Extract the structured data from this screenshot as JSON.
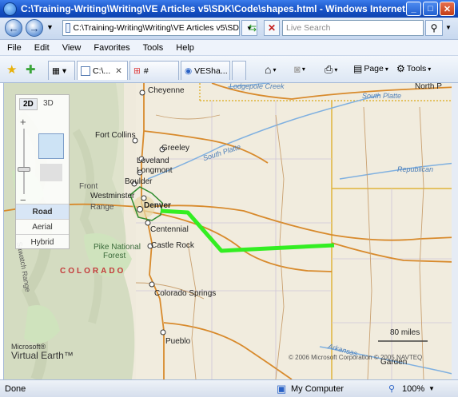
{
  "window": {
    "title": "C:\\Training-Writing\\Writing\\VE Articles v5\\SDK\\Code\\shapes.html - Windows Internet...",
    "minimize": "_",
    "maximize": "□",
    "close": "✕"
  },
  "navbar": {
    "address": "C:\\Training-Writing\\Writing\\VE Articles v5\\SD",
    "search_placeholder": "Live Search"
  },
  "menu": {
    "items": [
      "File",
      "Edit",
      "View",
      "Favorites",
      "Tools",
      "Help"
    ]
  },
  "tabs": [
    {
      "label": "C:\\...",
      "active": true
    },
    {
      "label": "#",
      "active": false
    },
    {
      "label": "VESha...",
      "active": false
    }
  ],
  "toolbar": {
    "page_label": "Page",
    "tools_label": "Tools"
  },
  "map": {
    "view_2d": "2D",
    "view_3d": "3D",
    "styles": [
      "Road",
      "Aerial",
      "Hybrid"
    ],
    "selected_style": "Road",
    "state_label": "COLORADO",
    "cities": [
      "Cheyenne",
      "Fort Collins",
      "Greeley",
      "Loveland",
      "Longmont",
      "Boulder",
      "Westminster",
      "Denver",
      "Centennial",
      "Castle Rock",
      "Colorado Springs",
      "Pueblo"
    ],
    "other_labels": {
      "forest": "Pike National",
      "forest2": "Forest",
      "river_south_platte": "South Platte",
      "river_south_platte2": "South Platte",
      "river_republican": "Republican",
      "lodgepole": "Lodgepole Creek",
      "north_p": "North P",
      "garden": "Garden",
      "front": "Front",
      "range": "Range",
      "sawatch": "Sawatch Range",
      "arkansas": "Arkansas"
    },
    "scale": "80 miles",
    "logo_line1": "Microsoft®",
    "logo_line2": "Virtual Earth™",
    "copyright": "© 2006 Microsoft Corporation   © 2005 NAVTEQ",
    "route_color": "#33ee22"
  },
  "status": {
    "left": "Done",
    "zone": "My Computer",
    "zoom": "100%"
  }
}
